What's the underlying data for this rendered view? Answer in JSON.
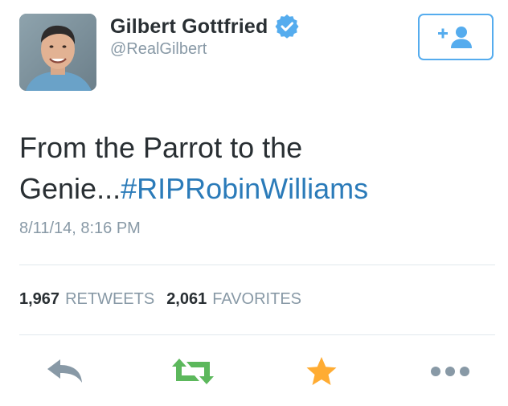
{
  "author": {
    "display_name": "Gilbert Gottfried",
    "handle": "@RealGilbert",
    "verified": true,
    "avatar_icon": "profile-photo"
  },
  "follow_button": {
    "icon": "add-user-icon"
  },
  "tweet": {
    "text": "From the Parrot to the Genie...",
    "hashtag": "#RIPRobinWilliams",
    "timestamp": "8/11/14, 8:16 PM"
  },
  "stats": {
    "retweets_count": "1,967",
    "retweets_label": "RETWEETS",
    "favorites_count": "2,061",
    "favorites_label": "FAVORITES"
  },
  "actions": [
    {
      "name": "reply",
      "icon": "reply-icon"
    },
    {
      "name": "retweet",
      "icon": "retweet-icon"
    },
    {
      "name": "favorite",
      "icon": "star-icon"
    },
    {
      "name": "more",
      "icon": "more-dots-icon"
    }
  ],
  "colors": {
    "accent_blue": "#55acee",
    "hashtag_blue": "#2b7bb9",
    "verified_blue": "#55acee",
    "retweet_green": "#5cb85c",
    "favorite_gold": "#ffac33",
    "muted_gray": "#8899a6",
    "action_gray": "#8899a6"
  }
}
